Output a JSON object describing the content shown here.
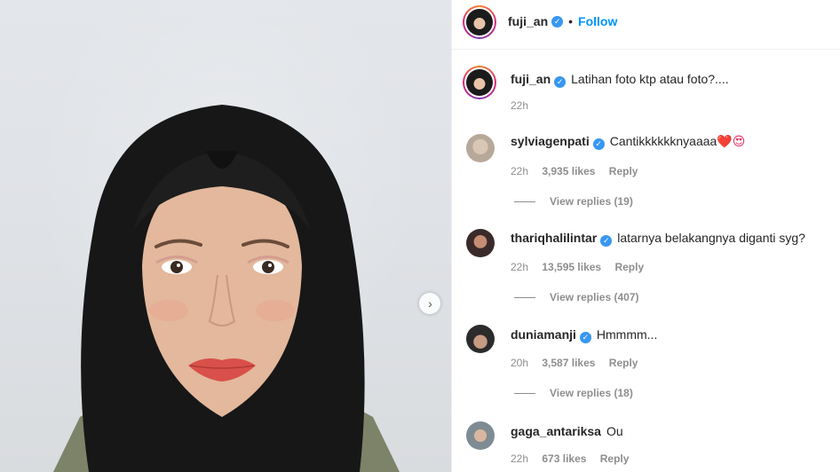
{
  "header": {
    "username": "fuji_an",
    "verified_badge": "✓",
    "separator": "•",
    "follow_label": "Follow"
  },
  "caption": {
    "username": "fuji_an",
    "text": "Latihan foto ktp atau foto?....",
    "time": "22h"
  },
  "comments": [
    {
      "username": "sylviagenpati",
      "text": "Cantikkkkkknyaaaa",
      "emoji": "❤️😍",
      "time": "22h",
      "likes": "3,935 likes",
      "reply": "Reply",
      "view_replies": "View replies (19)"
    },
    {
      "username": "thariqhalilintar",
      "text": "latarnya belakangnya diganti syg?",
      "time": "22h",
      "likes": "13,595 likes",
      "reply": "Reply",
      "view_replies": "View replies (407)"
    },
    {
      "username": "duniamanji",
      "text": "Hmmmm...",
      "time": "20h",
      "likes": "3,587 likes",
      "reply": "Reply",
      "view_replies": "View replies (18)"
    },
    {
      "username": "gaga_antariksa",
      "text": "Ou",
      "time": "22h",
      "likes": "673 likes",
      "reply": "Reply"
    }
  ],
  "icons": {
    "next": "chevron-right-icon",
    "verified": "verified-badge-icon"
  },
  "colors": {
    "follow_blue": "#0095f6",
    "verified_blue": "#3897f0",
    "meta_gray": "#8e8e8e"
  }
}
